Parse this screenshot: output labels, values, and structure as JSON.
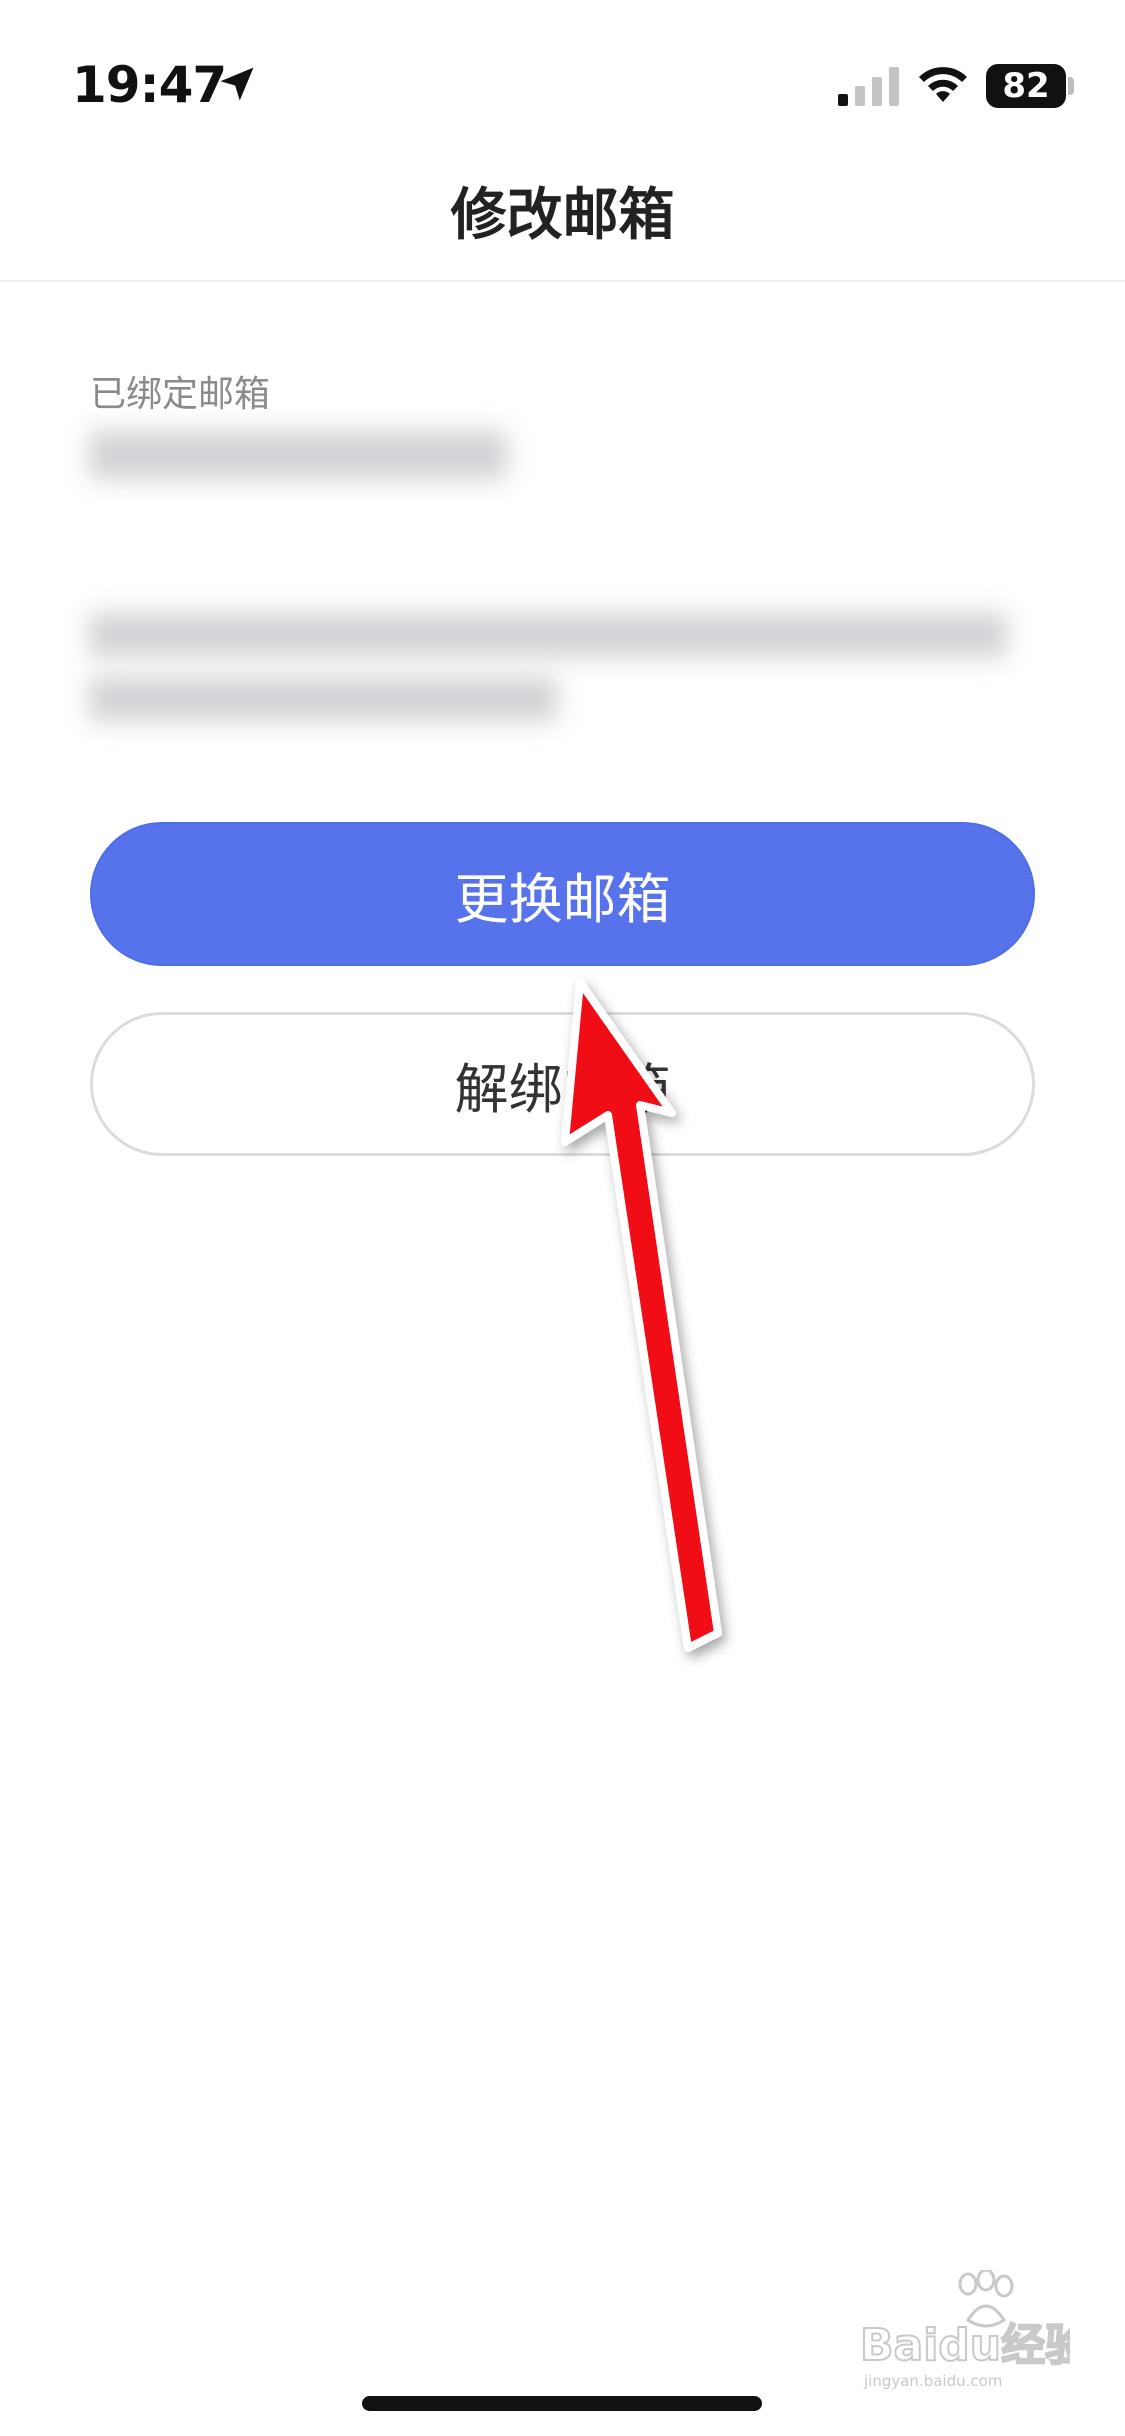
{
  "status_bar": {
    "time": "19:47",
    "battery_level": "82",
    "location_icon": "location-arrow-icon",
    "signal_icon": "cellular-signal-icon",
    "wifi_icon": "wifi-icon"
  },
  "nav": {
    "title": "修改邮箱"
  },
  "bound_email": {
    "label": "已绑定邮箱"
  },
  "buttons": {
    "change_label": "更换邮箱",
    "unbind_label": "解绑邮箱"
  },
  "watermark": {
    "brand": "Baidu经验",
    "url": "jingyan.baidu.com"
  },
  "colors": {
    "primary": "#5673ec",
    "annotation_arrow": "#f00a14",
    "label_gray": "#8a8a8a"
  }
}
